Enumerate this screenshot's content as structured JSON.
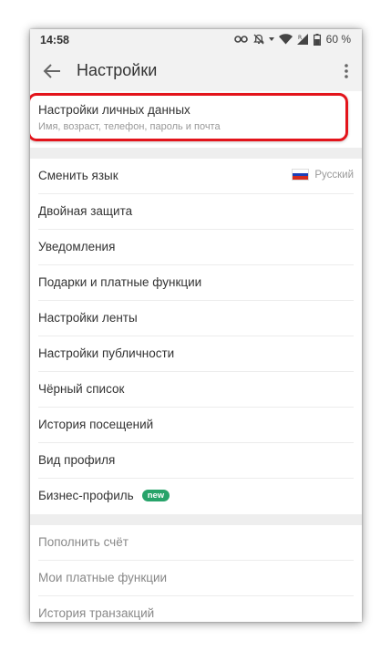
{
  "status_bar": {
    "time": "14:58",
    "battery_percent": "60 %",
    "icons": [
      "key-icon",
      "mute-icon",
      "notification-dot-icon",
      "wifi-icon",
      "signal-icon",
      "battery-icon"
    ]
  },
  "app_bar": {
    "title": "Настройки",
    "back_icon": "arrow-left-icon",
    "more_icon": "more-vert-icon"
  },
  "personal_data": {
    "title": "Настройки личных данных",
    "subtitle": "Имя, возраст, телефон, пароль и почта",
    "highlight_color": "#e3141b"
  },
  "settings_items": [
    {
      "label": "Сменить язык",
      "value": "Русский"
    },
    {
      "label": "Двойная защита"
    },
    {
      "label": "Уведомления"
    },
    {
      "label": "Подарки и платные функции"
    },
    {
      "label": "Настройки ленты"
    },
    {
      "label": "Настройки публичности"
    },
    {
      "label": "Чёрный список"
    },
    {
      "label": "История посещений"
    },
    {
      "label": "Вид профиля"
    },
    {
      "label": "Бизнес-профиль",
      "badge": "new"
    }
  ],
  "payment_items": [
    {
      "label": "Пополнить счёт"
    },
    {
      "label": "Мои платные функции"
    },
    {
      "label": "История транзакций"
    }
  ],
  "colors": {
    "badge_green": "#27a36a",
    "flag": [
      "#ffffff",
      "#1c3fb8",
      "#d52b1e"
    ]
  }
}
